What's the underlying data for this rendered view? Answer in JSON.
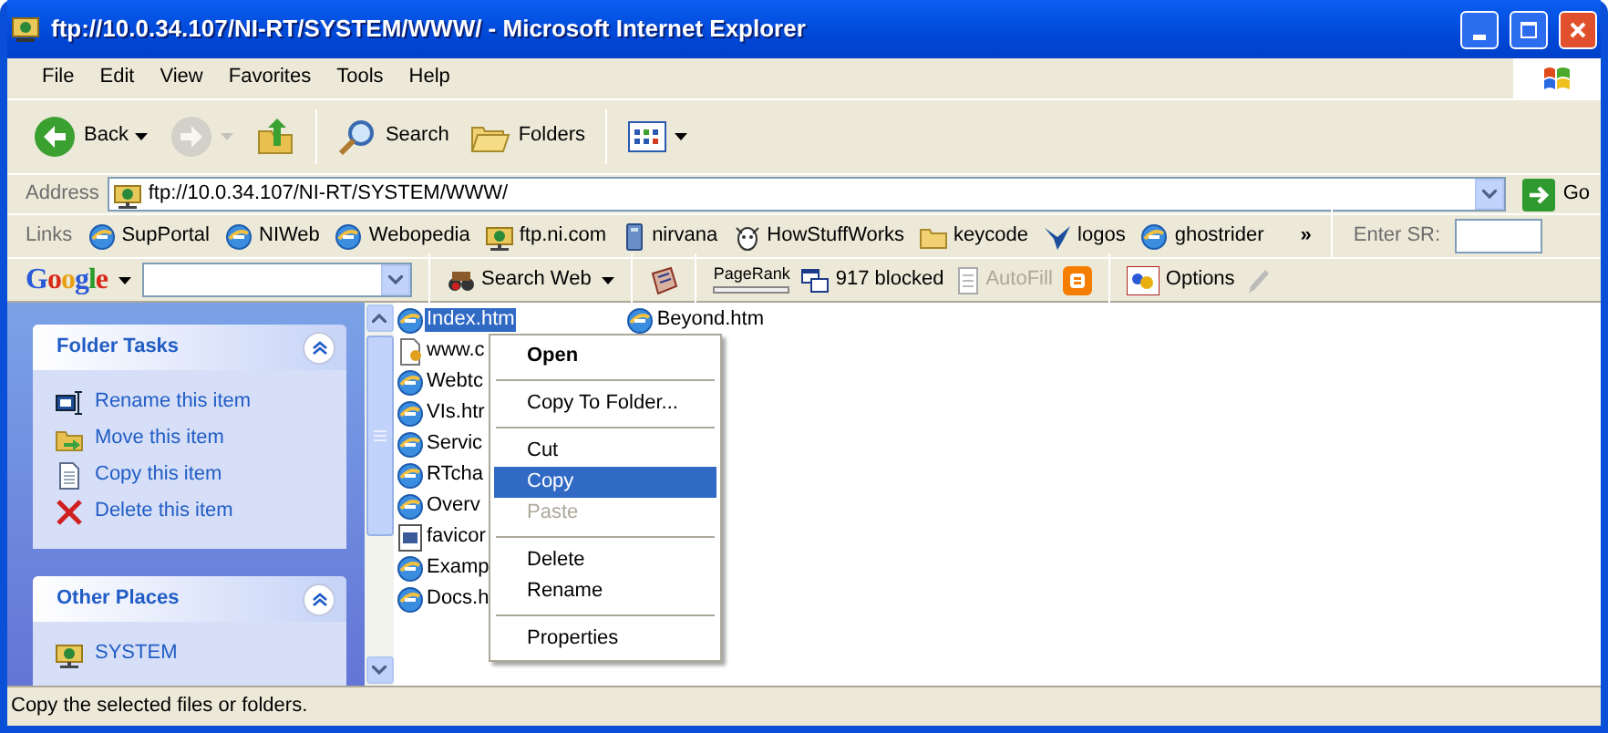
{
  "window": {
    "title": "ftp://10.0.34.107/NI-RT/SYSTEM/WWW/ - Microsoft Internet Explorer"
  },
  "menu": [
    "File",
    "Edit",
    "View",
    "Favorites",
    "Tools",
    "Help"
  ],
  "toolbar": [
    {
      "kind": "back",
      "label": "Back",
      "disabled": false
    },
    {
      "kind": "forward",
      "disabled": true
    },
    {
      "kind": "up",
      "disabled": false
    },
    {
      "kind": "search",
      "label": "Search",
      "disabled": false
    },
    {
      "kind": "folders",
      "label": "Folders",
      "disabled": false
    },
    {
      "kind": "views",
      "disabled": false
    }
  ],
  "address": {
    "label": "Address",
    "value": "ftp://10.0.34.107/NI-RT/SYSTEM/WWW/",
    "go": "Go"
  },
  "links": {
    "label": "Links",
    "items": [
      {
        "label": "SupPortal",
        "kind": "ie"
      },
      {
        "label": "NIWeb",
        "kind": "ie"
      },
      {
        "label": "Webopedia",
        "kind": "ie"
      },
      {
        "label": "ftp.ni.com",
        "kind": "ftp"
      },
      {
        "label": "nirvana",
        "kind": "computer"
      },
      {
        "label": "HowStuffWorks",
        "kind": "creature"
      },
      {
        "label": "keycode",
        "kind": "folder"
      },
      {
        "label": "logos",
        "kind": "bird"
      },
      {
        "label": "ghostrider",
        "kind": "ie"
      }
    ],
    "more": "»",
    "sr_label": "Enter SR:"
  },
  "google": {
    "logo": "Google",
    "search_button": "Search Web",
    "pagerank": "PageRank",
    "blocked": "917 blocked",
    "autofill": {
      "label": "AutoFill",
      "disabled": true
    },
    "options": "Options"
  },
  "sidebar": [
    {
      "title": "Folder Tasks",
      "expanded": true,
      "items": [
        {
          "label": "Rename this item",
          "kind": "rename"
        },
        {
          "label": "Move this item",
          "kind": "move"
        },
        {
          "label": "Copy this item",
          "kind": "copy"
        },
        {
          "label": "Delete this item",
          "kind": "delete"
        }
      ]
    },
    {
      "title": "Other Places",
      "expanded": true,
      "items": [
        {
          "label": "SYSTEM",
          "kind": "ftp"
        }
      ]
    }
  ],
  "files": [
    [
      {
        "name": "Index.htm",
        "kind": "ie",
        "selected": true
      },
      {
        "name": "www.c",
        "kind": "shortcut",
        "selected": false
      },
      {
        "name": "Webtc",
        "kind": "ie",
        "selected": false
      },
      {
        "name": "VIs.htr",
        "kind": "ie",
        "selected": false
      },
      {
        "name": "Servic",
        "kind": "ie",
        "selected": false
      },
      {
        "name": "RTcha",
        "kind": "ie",
        "selected": false
      },
      {
        "name": "Overv",
        "kind": "ie",
        "selected": false
      },
      {
        "name": "favicor",
        "kind": "image",
        "selected": false
      },
      {
        "name": "Examp",
        "kind": "ie",
        "selected": false
      },
      {
        "name": "Docs.h",
        "kind": "ie",
        "selected": false
      }
    ],
    [
      {
        "name": "Beyond.htm",
        "kind": "ie",
        "selected": false
      }
    ]
  ],
  "context_menu": [
    {
      "kind": "item",
      "label": "Open",
      "default": true,
      "selected": false,
      "disabled": false
    },
    {
      "kind": "separator"
    },
    {
      "kind": "item",
      "label": "Copy To Folder...",
      "default": false,
      "selected": false,
      "disabled": false
    },
    {
      "kind": "separator"
    },
    {
      "kind": "item",
      "label": "Cut",
      "default": false,
      "selected": false,
      "disabled": false
    },
    {
      "kind": "item",
      "label": "Copy",
      "default": false,
      "selected": true,
      "disabled": false
    },
    {
      "kind": "item",
      "label": "Paste",
      "default": false,
      "selected": false,
      "disabled": true
    },
    {
      "kind": "separator"
    },
    {
      "kind": "item",
      "label": "Delete",
      "default": false,
      "selected": false,
      "disabled": false
    },
    {
      "kind": "item",
      "label": "Rename",
      "default": false,
      "selected": false,
      "disabled": false
    },
    {
      "kind": "separator"
    },
    {
      "kind": "item",
      "label": "Properties",
      "default": false,
      "selected": false,
      "disabled": false
    }
  ],
  "status_bar": "Copy the selected files or folders."
}
